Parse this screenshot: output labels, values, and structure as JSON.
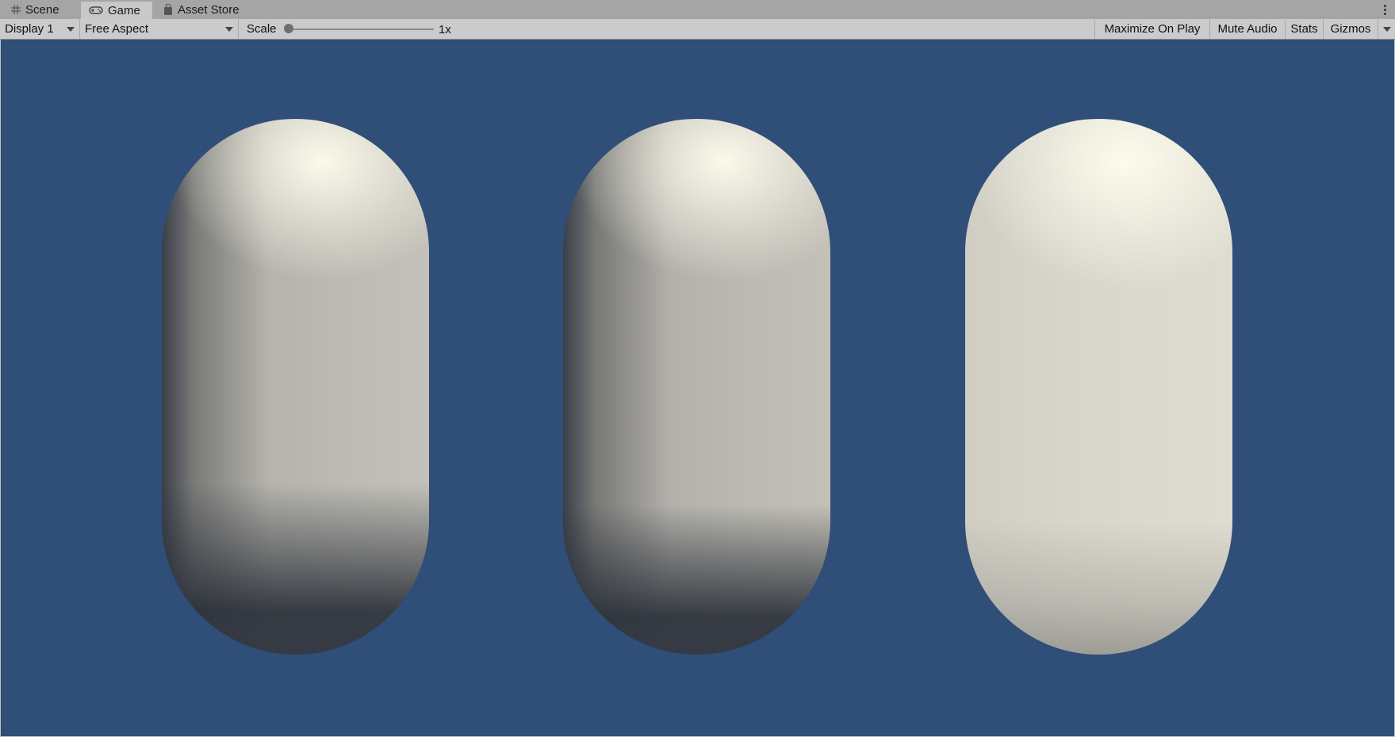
{
  "tabs": [
    {
      "label": "Scene",
      "icon": "grid-icon"
    },
    {
      "label": "Game",
      "icon": "gamepad-icon",
      "active": true
    },
    {
      "label": "Asset Store",
      "icon": "shopping-bag-icon"
    }
  ],
  "toolbar": {
    "display": "Display 1",
    "aspect": "Free Aspect",
    "scale_label": "Scale",
    "scale_value": "1x",
    "maximize": "Maximize On Play",
    "mute": "Mute Audio",
    "stats": "Stats",
    "gizmos": "Gizmos"
  },
  "viewport": {
    "background": "#2f4e78",
    "objects": [
      "capsule",
      "capsule",
      "capsule"
    ]
  }
}
